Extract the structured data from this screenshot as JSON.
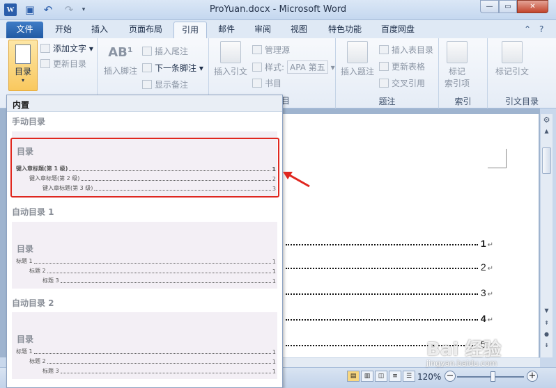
{
  "window": {
    "title": "ProYuan.docx - Microsoft Word"
  },
  "quick_access": {
    "logo": "W",
    "undo_glyph": "↶",
    "redo_glyph": "↷",
    "save_glyph": "▣",
    "custom_glyph": "▾"
  },
  "window_controls": {
    "minimize": "—",
    "maximize": "▭",
    "close": "✕"
  },
  "tabs": [
    "文件",
    "开始",
    "插入",
    "页面布局",
    "引用",
    "邮件",
    "审阅",
    "视图",
    "特色功能",
    "百度网盘"
  ],
  "active_tab": "引用",
  "ribbon": {
    "toc_group": {
      "toc_button": "目录",
      "add_text": "添加文字",
      "update_toc": "更新目录"
    },
    "footnote_group": {
      "insert_footnote": "插入脚注",
      "insert_endnote": "插入尾注",
      "next_footnote": "下一条脚注",
      "show_notes": "显示备注",
      "icon_label": "AB¹"
    },
    "citation_group": {
      "insert_citation": "插入引文",
      "manage_sources": "管理源",
      "style_label": "样式:",
      "style_value": "APA 第五",
      "bibliography": "书目",
      "group_label_tail": "目"
    },
    "captions_group": {
      "insert_caption": "插入题注",
      "insert_table_of_figures": "插入表目录",
      "update_table": "更新表格",
      "cross_reference": "交叉引用",
      "label": "题注"
    },
    "index_group": {
      "mark_entry_1": "标记",
      "mark_entry_2": "索引项",
      "label": "索引"
    },
    "toa_group": {
      "mark_citation": "标记引文",
      "label": "引文目录"
    }
  },
  "gallery": {
    "header": "内置",
    "sections": [
      {
        "title": "手动目录",
        "preview_title": "目录",
        "lines": [
          {
            "text": "键入章标题(第 1 级)",
            "page": "1"
          },
          {
            "text": "键入章标题(第 2 级)",
            "page": "2"
          },
          {
            "text": "键入章标题(第 3 级)",
            "page": "3"
          }
        ]
      },
      {
        "title": "自动目录 1",
        "preview_title": "目录",
        "lines": [
          {
            "text": "标题 1",
            "page": "1"
          },
          {
            "text": "标题 2",
            "page": "1"
          },
          {
            "text": "标题 3",
            "page": "1"
          }
        ]
      },
      {
        "title": "自动目录 2",
        "preview_title": "目录",
        "lines": [
          {
            "text": "标题 1",
            "page": "1"
          },
          {
            "text": "标题 2",
            "page": "1"
          },
          {
            "text": "标题 3",
            "page": "1"
          }
        ]
      }
    ]
  },
  "document": {
    "toc_pages": [
      "1",
      "2",
      "3",
      "4",
      "5"
    ],
    "paragraph_mark": "↵"
  },
  "statusbar": {
    "zoom": "120%",
    "minus": "−",
    "plus": "+"
  },
  "watermark": {
    "main": "Bai 经验",
    "sub": "jingyan.baidu.com"
  },
  "colors": {
    "accent": "#215aa3",
    "highlight": "#e0271f",
    "toc_button": "#f9c85e"
  }
}
